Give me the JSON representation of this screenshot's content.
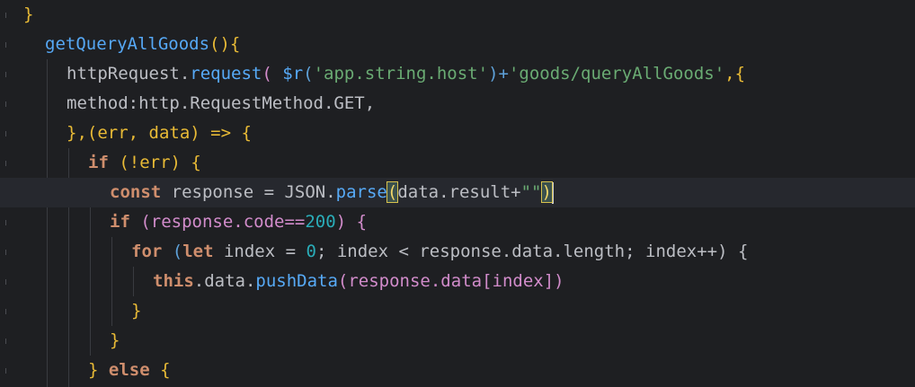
{
  "editor": {
    "lines": [
      {
        "t1": "}"
      },
      {
        "t1": "getQueryAllGoods",
        "t2": "(){"
      },
      {
        "t1": "httpRequest.",
        "t2": "request",
        "t3": "( ",
        "t4": "$r",
        "t5": "(",
        "t6": "'app.string.host'",
        "t7": ")+",
        "t8": "'goods/queryAllGoods'",
        "t9": ",{"
      },
      {
        "t1": "method:http.RequestMethod.GET,"
      },
      {
        "t1": "},(err, data) => {"
      },
      {
        "t1": "if",
        "t2": " (!err) {"
      },
      {
        "t1": "const",
        "t2": " response = JSON.",
        "t3": "parse",
        "t4": "(",
        "t5": "data.result+",
        "t6": "\"\"",
        "t7": ")"
      },
      {
        "t1": "if",
        "t2": " (response.code==",
        "t3": "200",
        "t4": ") {"
      },
      {
        "t1": "for",
        "t2": " (",
        "t3": "let",
        "t4": " index = ",
        "t5": "0",
        "t6": "; index < response.data.length; index++) {"
      },
      {
        "t1": "this",
        "t2": ".data.",
        "t3": "pushData",
        "t4": "(response.data[index])"
      },
      {
        "t1": "}"
      },
      {
        "t1": "}"
      },
      {
        "t1": "}",
        "t2": " else",
        "t3": " {"
      }
    ]
  },
  "gutter": {
    "icon": "lightbulb-icon",
    "accent": "#f2c55c"
  },
  "colors": {
    "background": "#1e1f22",
    "keyword": "#cf8e6d",
    "function": "#56a8f5",
    "string": "#6aab73",
    "number": "#2aacb8",
    "text": "#bcbec4"
  }
}
